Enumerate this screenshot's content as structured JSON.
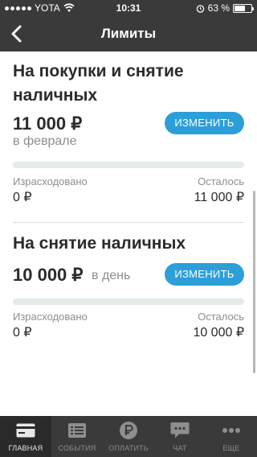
{
  "status_bar": {
    "carrier": "YOTA",
    "time": "10:31",
    "battery_percent": "63 %",
    "battery_level": 0.63
  },
  "nav": {
    "title": "Лимиты"
  },
  "limits": [
    {
      "title": "На покупки и снятие наличных",
      "amount": "11 000 ₽",
      "period": "в феврале",
      "change_label": "ИЗМЕНИТЬ",
      "spent_label": "Израсходовано",
      "spent_value": "0 ₽",
      "left_label": "Осталось",
      "left_value": "11 000 ₽",
      "spent_fraction": 0
    },
    {
      "title": "На снятие наличных",
      "amount": "10 000 ₽",
      "period": "в день",
      "change_label": "ИЗМЕНИТЬ",
      "spent_label": "Израсходовано",
      "spent_value": "0 ₽",
      "left_label": "Осталось",
      "left_value": "10 000 ₽",
      "spent_fraction": 0
    }
  ],
  "tabs": [
    {
      "label": "ГЛАВНАЯ",
      "icon": "card-icon",
      "active": true
    },
    {
      "label": "СОБЫТИЯ",
      "icon": "list-icon",
      "active": false
    },
    {
      "label": "ОПЛАТИТЬ",
      "icon": "ruble-icon",
      "active": false
    },
    {
      "label": "ЧАТ",
      "icon": "chat-icon",
      "active": false
    },
    {
      "label": "ЕЩЕ",
      "icon": "more-icon",
      "active": false
    }
  ]
}
